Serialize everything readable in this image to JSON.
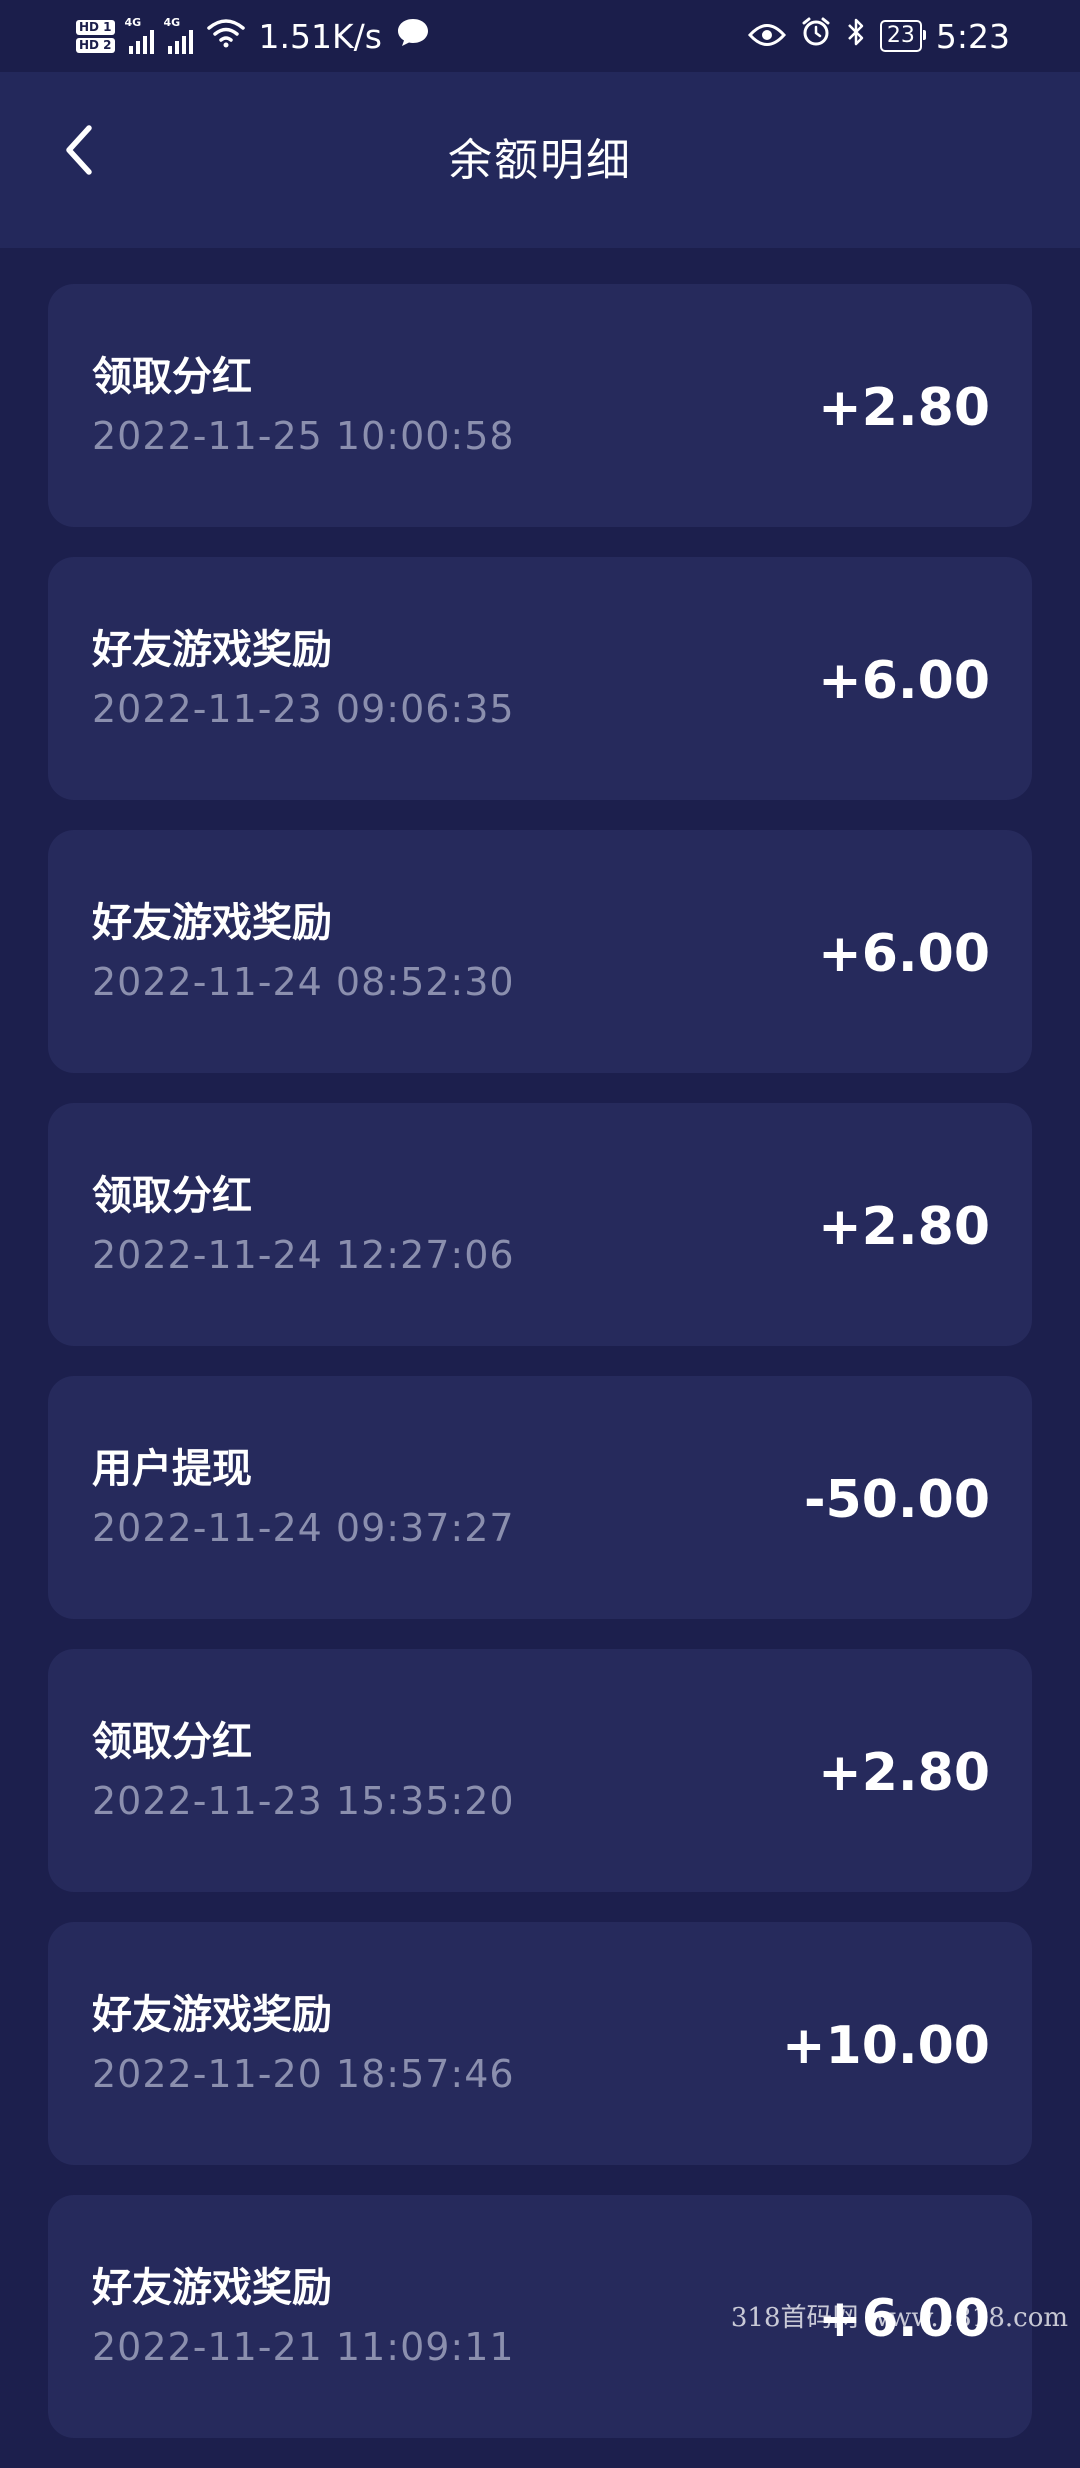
{
  "status_bar": {
    "hd1": "HD 1",
    "hd2": "HD 2",
    "net1": "4G",
    "net2": "4G",
    "speed": "1.51K/s",
    "battery": "23",
    "time": "5:23",
    "icons": [
      "hd-icon",
      "signal-icon",
      "wifi-icon",
      "chat-bubble-icon",
      "eye-icon",
      "alarm-icon",
      "bluetooth-icon",
      "battery-icon"
    ]
  },
  "header": {
    "title": "余额明细",
    "back_icon": "chevron-left-icon"
  },
  "records": [
    {
      "title": "领取分红",
      "time": "2022-11-25 10:00:58",
      "amount": "+2.80"
    },
    {
      "title": "好友游戏奖励",
      "time": "2022-11-23 09:06:35",
      "amount": "+6.00"
    },
    {
      "title": "好友游戏奖励",
      "time": "2022-11-24 08:52:30",
      "amount": "+6.00"
    },
    {
      "title": "领取分红",
      "time": "2022-11-24 12:27:06",
      "amount": "+2.80"
    },
    {
      "title": "用户提现",
      "time": "2022-11-24 09:37:27",
      "amount": "-50.00"
    },
    {
      "title": "领取分红",
      "time": "2022-11-23 15:35:20",
      "amount": "+2.80"
    },
    {
      "title": "好友游戏奖励",
      "time": "2022-11-20 18:57:46",
      "amount": "+10.00"
    },
    {
      "title": "好友游戏奖励",
      "time": "2022-11-21 11:09:11",
      "amount": "+6.00"
    }
  ],
  "watermark": "318首码网 www.1318.com",
  "colors": {
    "background": "#1c1f4d",
    "header": "#23285b",
    "card": "#262a5c",
    "text_primary": "#ffffff",
    "text_secondary": "#8b8fae"
  }
}
